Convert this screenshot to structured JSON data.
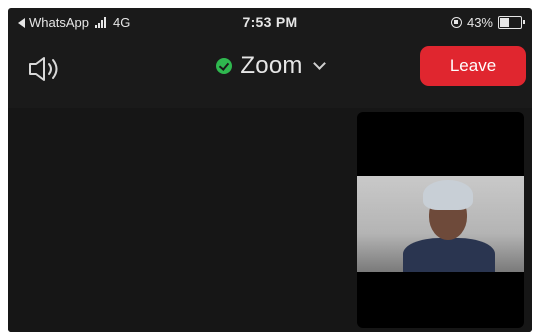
{
  "status_bar": {
    "back_app": "WhatsApp",
    "network": "4G",
    "time": "7:53 PM",
    "battery_percent": "43%",
    "battery_level": 0.43
  },
  "header": {
    "meeting_title": "Zoom",
    "leave_label": "Leave",
    "leave_color": "#e0262f",
    "secure_color": "#2fb84f",
    "icons": [
      "speaker-icon",
      "shield-icon",
      "chevron-down-icon"
    ]
  }
}
